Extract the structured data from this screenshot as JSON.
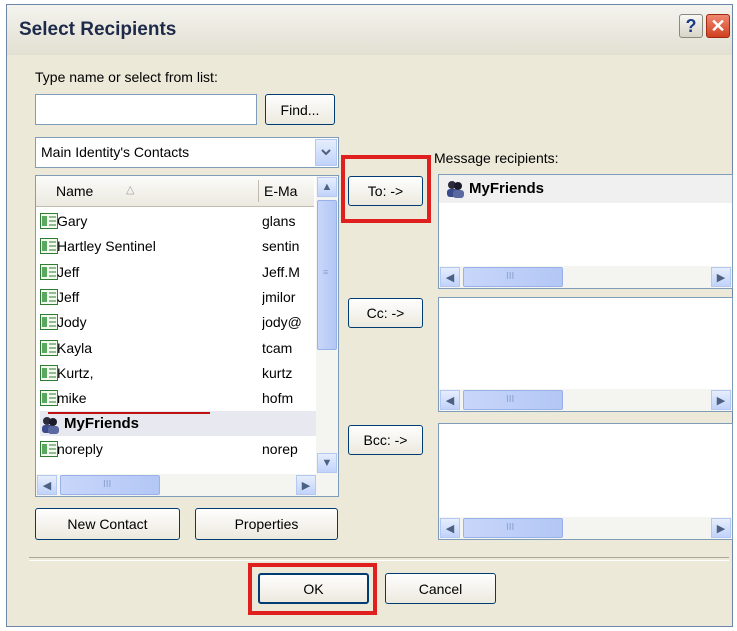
{
  "window": {
    "title": "Select Recipients"
  },
  "search": {
    "label": "Type name or select from list:",
    "value": "",
    "find_label": "Find..."
  },
  "address_book": {
    "selected": "Main Identity's Contacts"
  },
  "contacts": {
    "columns": [
      "Name",
      "E-Ma"
    ],
    "rows": [
      {
        "name": "Gary",
        "email": "glans",
        "type": "contact"
      },
      {
        "name": "Hartley Sentinel",
        "email": "sentin",
        "type": "contact"
      },
      {
        "name": "Jeff",
        "email": "Jeff.M",
        "type": "contact"
      },
      {
        "name": "Jeff",
        "email": "jmilor",
        "type": "contact"
      },
      {
        "name": "Jody",
        "email": "jody@",
        "type": "contact"
      },
      {
        "name": "Kayla",
        "email": "tcam",
        "type": "contact"
      },
      {
        "name": "Kurtz,",
        "email": "kurtz",
        "type": "contact"
      },
      {
        "name": "mike",
        "email": "hofm",
        "type": "contact"
      },
      {
        "name": "MyFriends",
        "email": "",
        "type": "group"
      },
      {
        "name": "noreply",
        "email": "norep",
        "type": "contact"
      }
    ]
  },
  "buttons": {
    "to": "To: ->",
    "cc": "Cc: ->",
    "bcc": "Bcc: ->",
    "new_contact": "New Contact",
    "properties": "Properties",
    "ok": "OK",
    "cancel": "Cancel"
  },
  "recipients": {
    "label": "Message recipients:",
    "to": [
      "MyFriends"
    ],
    "cc": [],
    "bcc": []
  },
  "scroll_glyph": "III",
  "icons": [
    "help-icon",
    "close-icon",
    "dropdown-arrow-icon",
    "contact-card-icon",
    "group-icon",
    "sort-arrow-icon",
    "scroll-up-icon",
    "scroll-down-icon",
    "scroll-left-icon",
    "scroll-right-icon"
  ],
  "colors": {
    "dialog_bg": "#ece9d8",
    "highlight_red": "#e0201e",
    "selection": "#e8e8f0",
    "button_border": "#003c74"
  }
}
